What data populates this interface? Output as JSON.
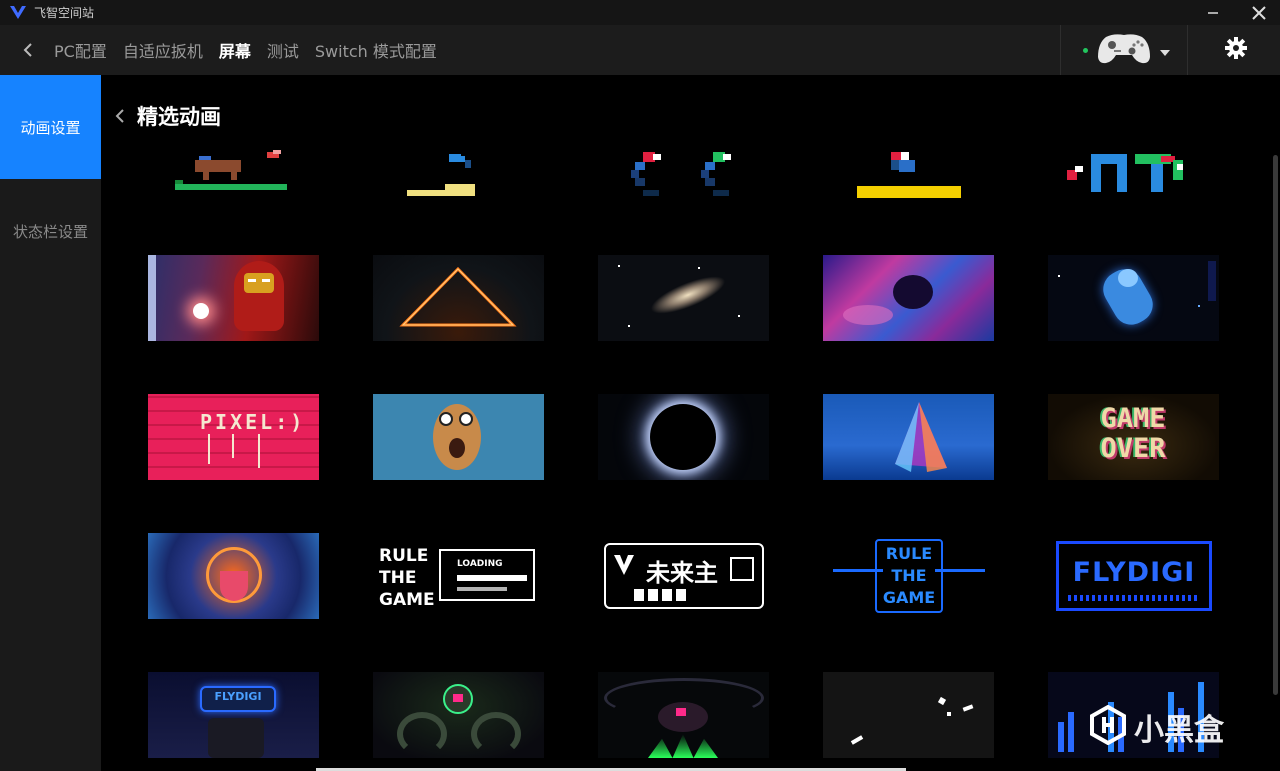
{
  "window": {
    "title": "飞智空间站"
  },
  "topnav": {
    "tabs": [
      {
        "label": "PC配置",
        "active": false
      },
      {
        "label": "自适应扳机",
        "active": false
      },
      {
        "label": "屏幕",
        "active": true
      },
      {
        "label": "测试",
        "active": false
      },
      {
        "label": "Switch 模式配置",
        "active": false
      }
    ]
  },
  "device": {
    "status_color": "#22c55e"
  },
  "sidebar": {
    "items": [
      {
        "label": "动画设置",
        "active": true
      },
      {
        "label": "状态栏设置",
        "active": false
      }
    ]
  },
  "main": {
    "title": "精选动画",
    "rows": [
      {
        "items": [
          {
            "name": "pixel-running-horse",
            "text": ""
          },
          {
            "name": "pixel-stairs",
            "text": ""
          },
          {
            "name": "pixel-two-blocks",
            "text": ""
          },
          {
            "name": "pixel-yellow-bar",
            "text": ""
          },
          {
            "name": "pixel-colored-blocks",
            "text": ""
          }
        ]
      },
      {
        "items": [
          {
            "name": "iron-man",
            "text": ""
          },
          {
            "name": "neon-triangle",
            "text": ""
          },
          {
            "name": "galaxy",
            "text": ""
          },
          {
            "name": "fluid-art",
            "text": ""
          },
          {
            "name": "astronaut",
            "text": ""
          }
        ]
      },
      {
        "items": [
          {
            "name": "pixel-graffiti",
            "text": "PIXEL:)"
          },
          {
            "name": "shocked-egg",
            "text": ""
          },
          {
            "name": "solar-eclipse",
            "text": ""
          },
          {
            "name": "crystal-pyramid",
            "text": ""
          },
          {
            "name": "game-over",
            "text": "GAME OVER"
          }
        ]
      },
      {
        "items": [
          {
            "name": "rolling-tongue",
            "text": ""
          },
          {
            "name": "rule-the-game-loading",
            "text": "RULE THE GAME",
            "sub": "LOADING"
          },
          {
            "name": "weilai-zhu",
            "text": "未来主",
            "sub": ""
          },
          {
            "name": "rule-the-game-blue",
            "text": "RULE THE GAME"
          },
          {
            "name": "flydigi-blue",
            "text": "FLYDIGI"
          }
        ]
      },
      {
        "items": [
          {
            "name": "flydigi-robot",
            "text": "FLYDIGI"
          },
          {
            "name": "octopus-robot",
            "text": ""
          },
          {
            "name": "green-creature",
            "text": ""
          },
          {
            "name": "dark-particles",
            "text": ""
          },
          {
            "name": "blue-equalizer",
            "text": ""
          }
        ]
      }
    ]
  },
  "watermark": {
    "text": "小黑盒"
  },
  "colors": {
    "accent": "#1683ff",
    "bg": "#000000"
  }
}
